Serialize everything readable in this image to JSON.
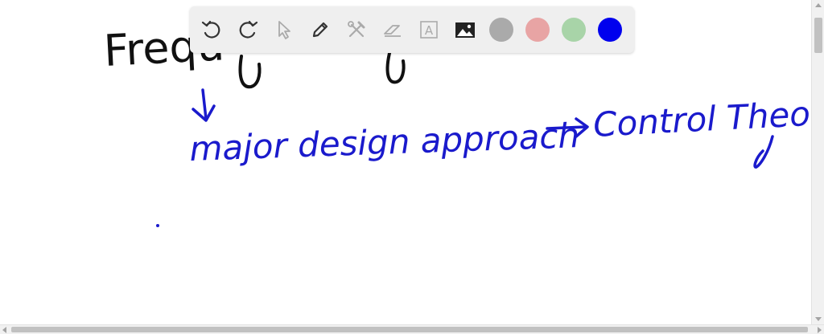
{
  "handwriting": {
    "black_text": "Frequ",
    "blue_line": "major design approach",
    "blue_target": "Control Theory"
  },
  "toolbar": {
    "tools": [
      {
        "name": "undo-icon"
      },
      {
        "name": "redo-icon"
      },
      {
        "name": "select-pointer-icon"
      },
      {
        "name": "pen-icon"
      },
      {
        "name": "tools-icon"
      },
      {
        "name": "eraser-icon"
      },
      {
        "name": "text-box-icon",
        "glyph": "A"
      },
      {
        "name": "image-icon"
      }
    ],
    "colors": [
      "#aaaaaa",
      "#e8a4a4",
      "#a8d4a8",
      "#0000ee"
    ],
    "selected_color": "#0000ee"
  },
  "colors": {
    "ink_black": "#111111",
    "ink_blue": "#1a1acc"
  }
}
